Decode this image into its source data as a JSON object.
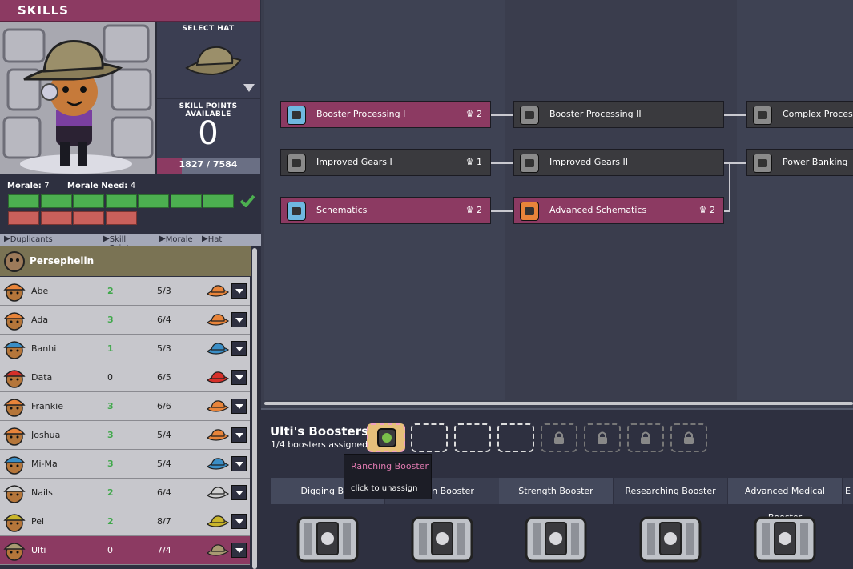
{
  "header": {
    "title": "SKILLS"
  },
  "hat": {
    "label": "SELECT HAT"
  },
  "skill_points": {
    "label": "SKILL POINTS AVAILABLE",
    "value": "0",
    "xp_text": "1827 / 7584",
    "xp_fraction": 0.24
  },
  "morale": {
    "morale_label": "Morale:",
    "morale_value": "7",
    "need_label": "Morale Need:",
    "need_value": "4",
    "green_count": 7,
    "red_count": 4
  },
  "columns": {
    "duplicants": "Duplicants",
    "skill_points": "Skill Points",
    "morale": "Morale",
    "hat": "Hat"
  },
  "group": {
    "name": "Persephelin"
  },
  "duplicants": [
    {
      "name": "Abe",
      "points": "2",
      "morale": "5/3",
      "hat_color": "#e8843a"
    },
    {
      "name": "Ada",
      "points": "3",
      "morale": "6/4",
      "hat_color": "#e8843a"
    },
    {
      "name": "Banhi",
      "points": "1",
      "morale": "5/3",
      "hat_color": "#3a8ec6"
    },
    {
      "name": "Data",
      "points": "0",
      "morale": "6/5",
      "hat_color": "#d6302a"
    },
    {
      "name": "Frankie",
      "points": "3",
      "morale": "6/6",
      "hat_color": "#e8843a"
    },
    {
      "name": "Joshua",
      "points": "3",
      "morale": "5/4",
      "hat_color": "#e8843a"
    },
    {
      "name": "Mi-Ma",
      "points": "3",
      "morale": "5/4",
      "hat_color": "#3a8ec6"
    },
    {
      "name": "Nails",
      "points": "2",
      "morale": "6/4",
      "hat_color": "#cfcfcf"
    },
    {
      "name": "Pei",
      "points": "2",
      "morale": "8/7",
      "hat_color": "#c9b52b"
    },
    {
      "name": "Ulti",
      "points": "0",
      "morale": "7/4",
      "hat_color": "#a89a72"
    }
  ],
  "skills": [
    {
      "id": "bp1",
      "label": "Booster Processing I",
      "count": "2",
      "owned": true,
      "icon_color": "#6fb8e0"
    },
    {
      "id": "ig1",
      "label": "Improved Gears I",
      "count": "1",
      "owned": false,
      "icon_color": "#8a8a8a"
    },
    {
      "id": "sch",
      "label": "Schematics",
      "count": "2",
      "owned": true,
      "icon_color": "#6fb8e0"
    },
    {
      "id": "bp2",
      "label": "Booster Processing II",
      "count": "",
      "owned": false,
      "icon_color": "#8a8a8a"
    },
    {
      "id": "ig2",
      "label": "Improved Gears II",
      "count": "",
      "owned": false,
      "icon_color": "#8a8a8a"
    },
    {
      "id": "asch",
      "label": "Advanced Schematics",
      "count": "2",
      "owned": true,
      "icon_color": "#e8843a"
    },
    {
      "id": "cp",
      "label": "Complex Processing",
      "count": "",
      "owned": false,
      "icon_color": "#8a8a8a"
    },
    {
      "id": "pb",
      "label": "Power Banking",
      "count": "",
      "owned": false,
      "icon_color": "#8a8a8a"
    }
  ],
  "boosters": {
    "title": "Ulti's Boosters",
    "subtitle": "1/4 boosters assigned",
    "open_slots": 3,
    "locked_slots": 4
  },
  "tooltip": {
    "title": "Ranching Booster",
    "action": "click to unassign"
  },
  "booster_tabs": [
    "Digging Boo",
    "uction Booster",
    "Strength Booster",
    "Researching Booster",
    "Advanced Medical Booster",
    "E"
  ],
  "colors": {
    "accent": "#8c3a62",
    "positive": "#3fa84a",
    "panel": "#2e3040"
  }
}
